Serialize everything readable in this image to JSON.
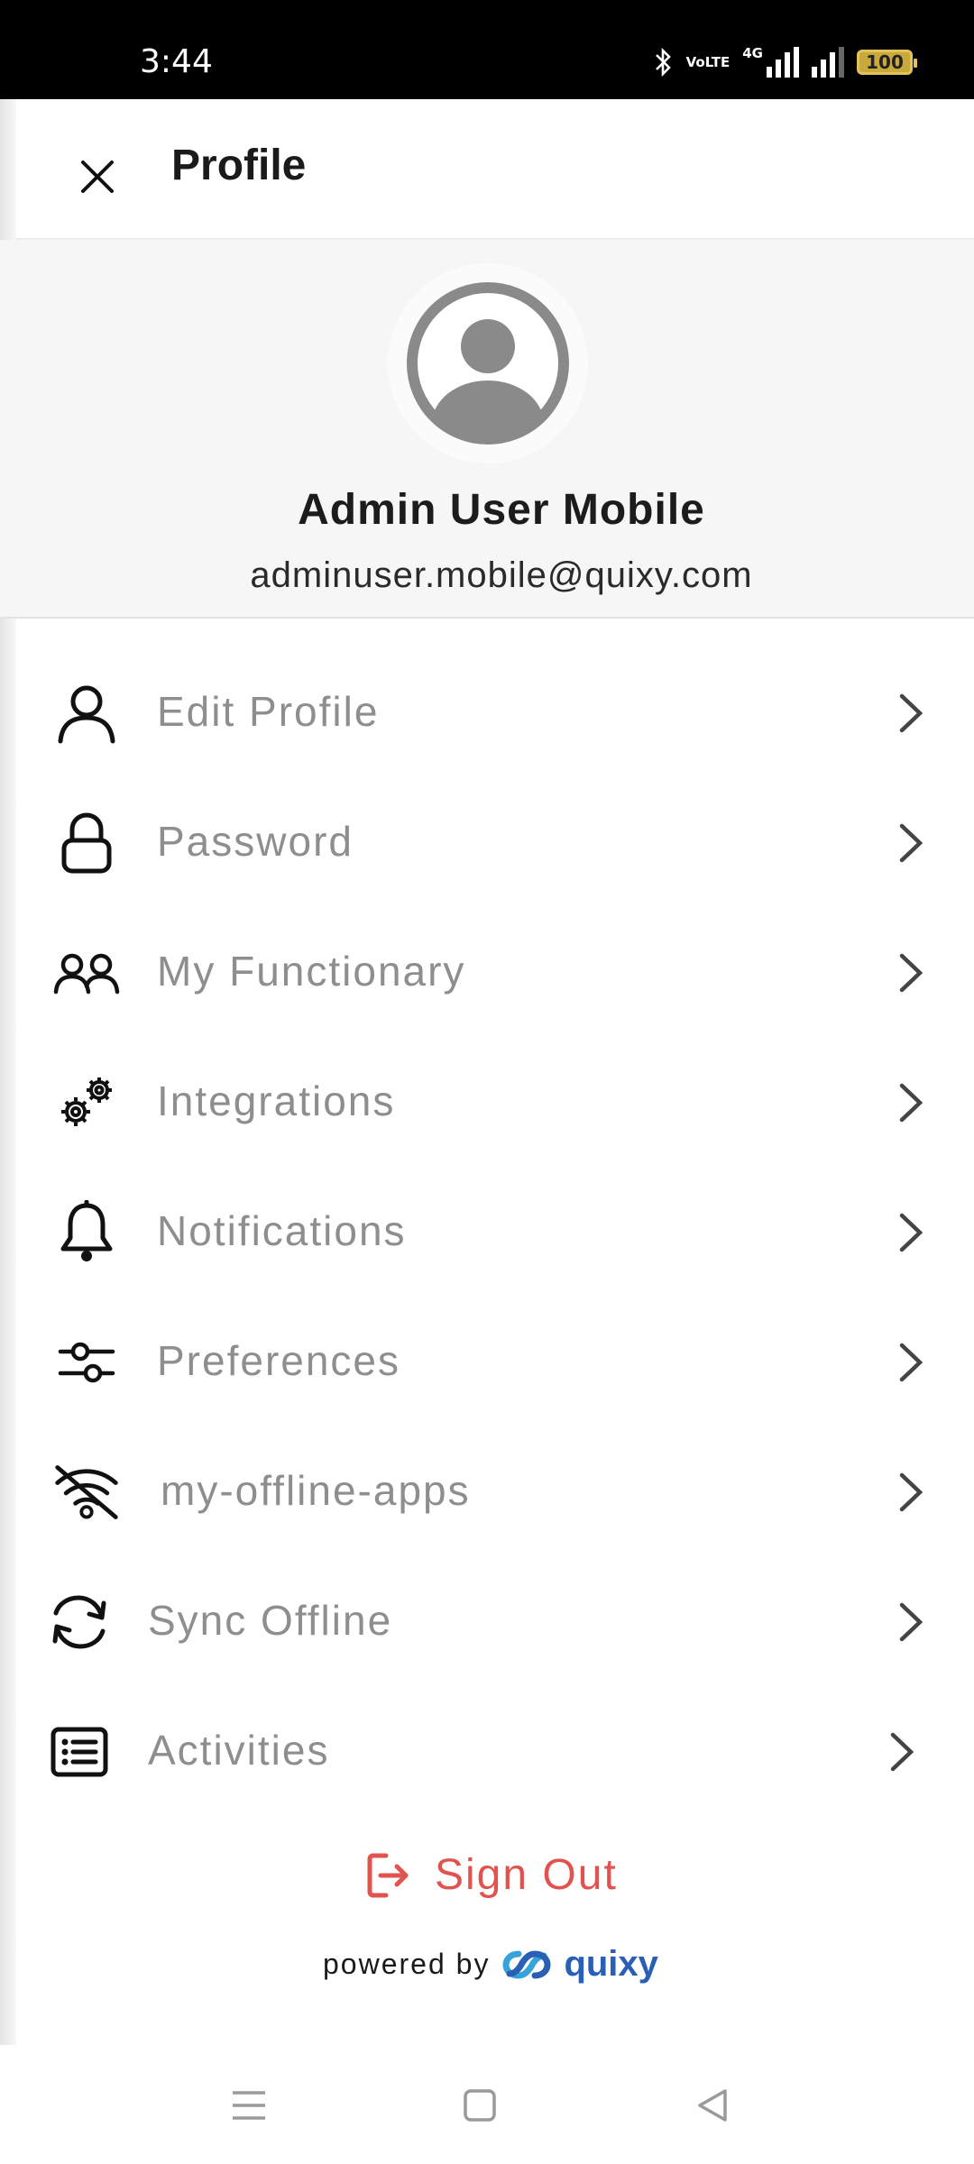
{
  "status_bar": {
    "time": "3:44",
    "network_label": "VoLTE",
    "network_type": "4G",
    "battery": "100"
  },
  "header": {
    "title": "Profile",
    "close_icon": "close-icon"
  },
  "profile": {
    "name": "Admin User Mobile",
    "email": "adminuser.mobile@quixy.com",
    "avatar_icon": "user-avatar-icon"
  },
  "menu": {
    "items": [
      {
        "label": "Edit Profile",
        "icon": "user-icon"
      },
      {
        "label": "Password",
        "icon": "lock-icon"
      },
      {
        "label": "My Functionary",
        "icon": "users-icon"
      },
      {
        "label": "Integrations",
        "icon": "gears-icon"
      },
      {
        "label": "Notifications",
        "icon": "bell-icon"
      },
      {
        "label": "Preferences",
        "icon": "sliders-icon"
      },
      {
        "label": "my-offline-apps",
        "icon": "wifi-off-icon"
      },
      {
        "label": "Sync Offline",
        "icon": "sync-icon"
      },
      {
        "label": "Activities",
        "icon": "list-icon"
      }
    ]
  },
  "footer": {
    "sign_out": "Sign Out",
    "powered_by": "powered by",
    "brand": "quixy"
  },
  "colors": {
    "accent_red": "#e0534f",
    "brand_blue": "#2a5fb6",
    "label_gray": "#8e8e8e"
  }
}
